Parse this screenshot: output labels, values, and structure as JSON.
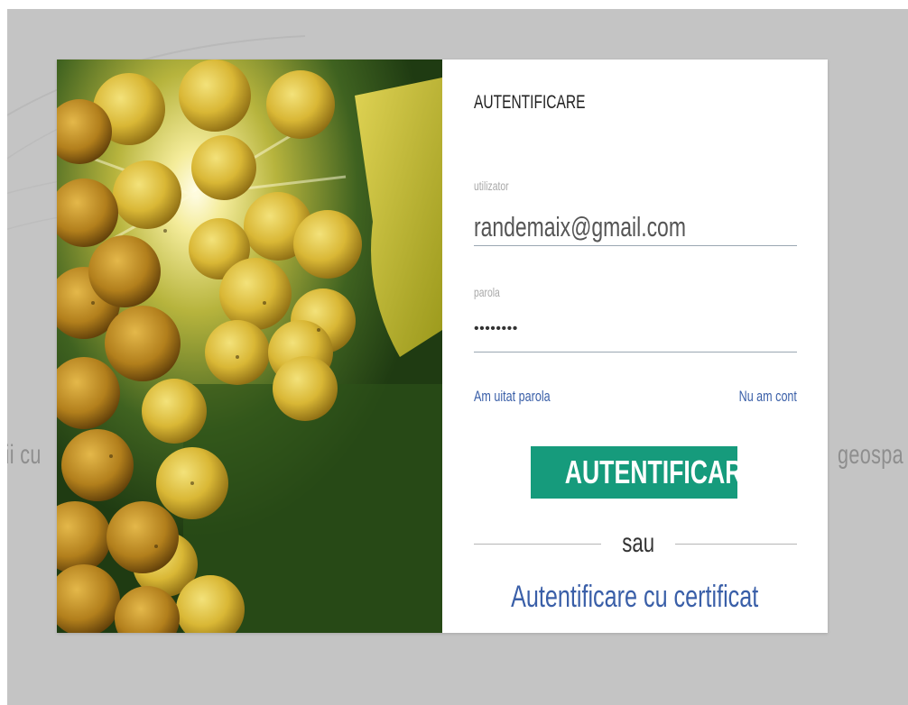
{
  "background": {
    "left_text": "rii cu",
    "right_text": "geospa"
  },
  "login": {
    "title": "AUTENTIFICARE",
    "username_label": "utilizator",
    "username_value": "randemaix@gmail.com",
    "password_label": "parola",
    "password_masked": "••••••••",
    "forgot_password": "Am uitat parola",
    "no_account": "Nu am cont",
    "submit_label": "AUTENTIFICARE",
    "or_text": "sau",
    "certificate_link": "Autentificare cu certificat"
  },
  "colors": {
    "accent": "#169b7c",
    "link": "#3a5fa8",
    "overlay": "#c4c4c4"
  },
  "image": {
    "subject": "grape-cluster-photo"
  }
}
